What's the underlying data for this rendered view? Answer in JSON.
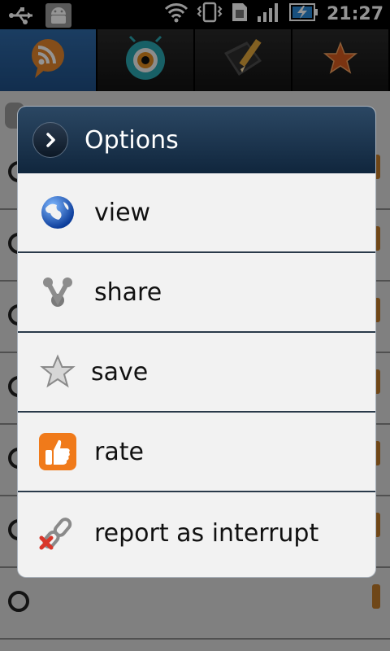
{
  "status_bar": {
    "time": "21:27",
    "icons": [
      "usb-icon",
      "android-debug-icon",
      "wifi-icon",
      "vibrate-icon",
      "sim-icon",
      "signal-icon",
      "battery-charging-icon"
    ]
  },
  "tabs": [
    {
      "name": "rss-bubble-icon",
      "active": true
    },
    {
      "name": "eye-creature-icon",
      "active": false
    },
    {
      "name": "notepad-pencil-icon",
      "active": false
    },
    {
      "name": "star-icon",
      "active": false
    }
  ],
  "dialog": {
    "title": "Options",
    "items": [
      {
        "label": "view",
        "icon": "globe-icon"
      },
      {
        "label": "share",
        "icon": "share-network-icon"
      },
      {
        "label": "save",
        "icon": "star-outline-icon"
      },
      {
        "label": "rate",
        "icon": "thumbs-up-icon"
      },
      {
        "label": "report as interrupt",
        "icon": "broken-chain-icon"
      }
    ]
  },
  "colors": {
    "header_top": "#2b4763",
    "header_bottom": "#10263d",
    "active_tab": "#2f6aa8",
    "rate_orange": "#f07a1a"
  }
}
